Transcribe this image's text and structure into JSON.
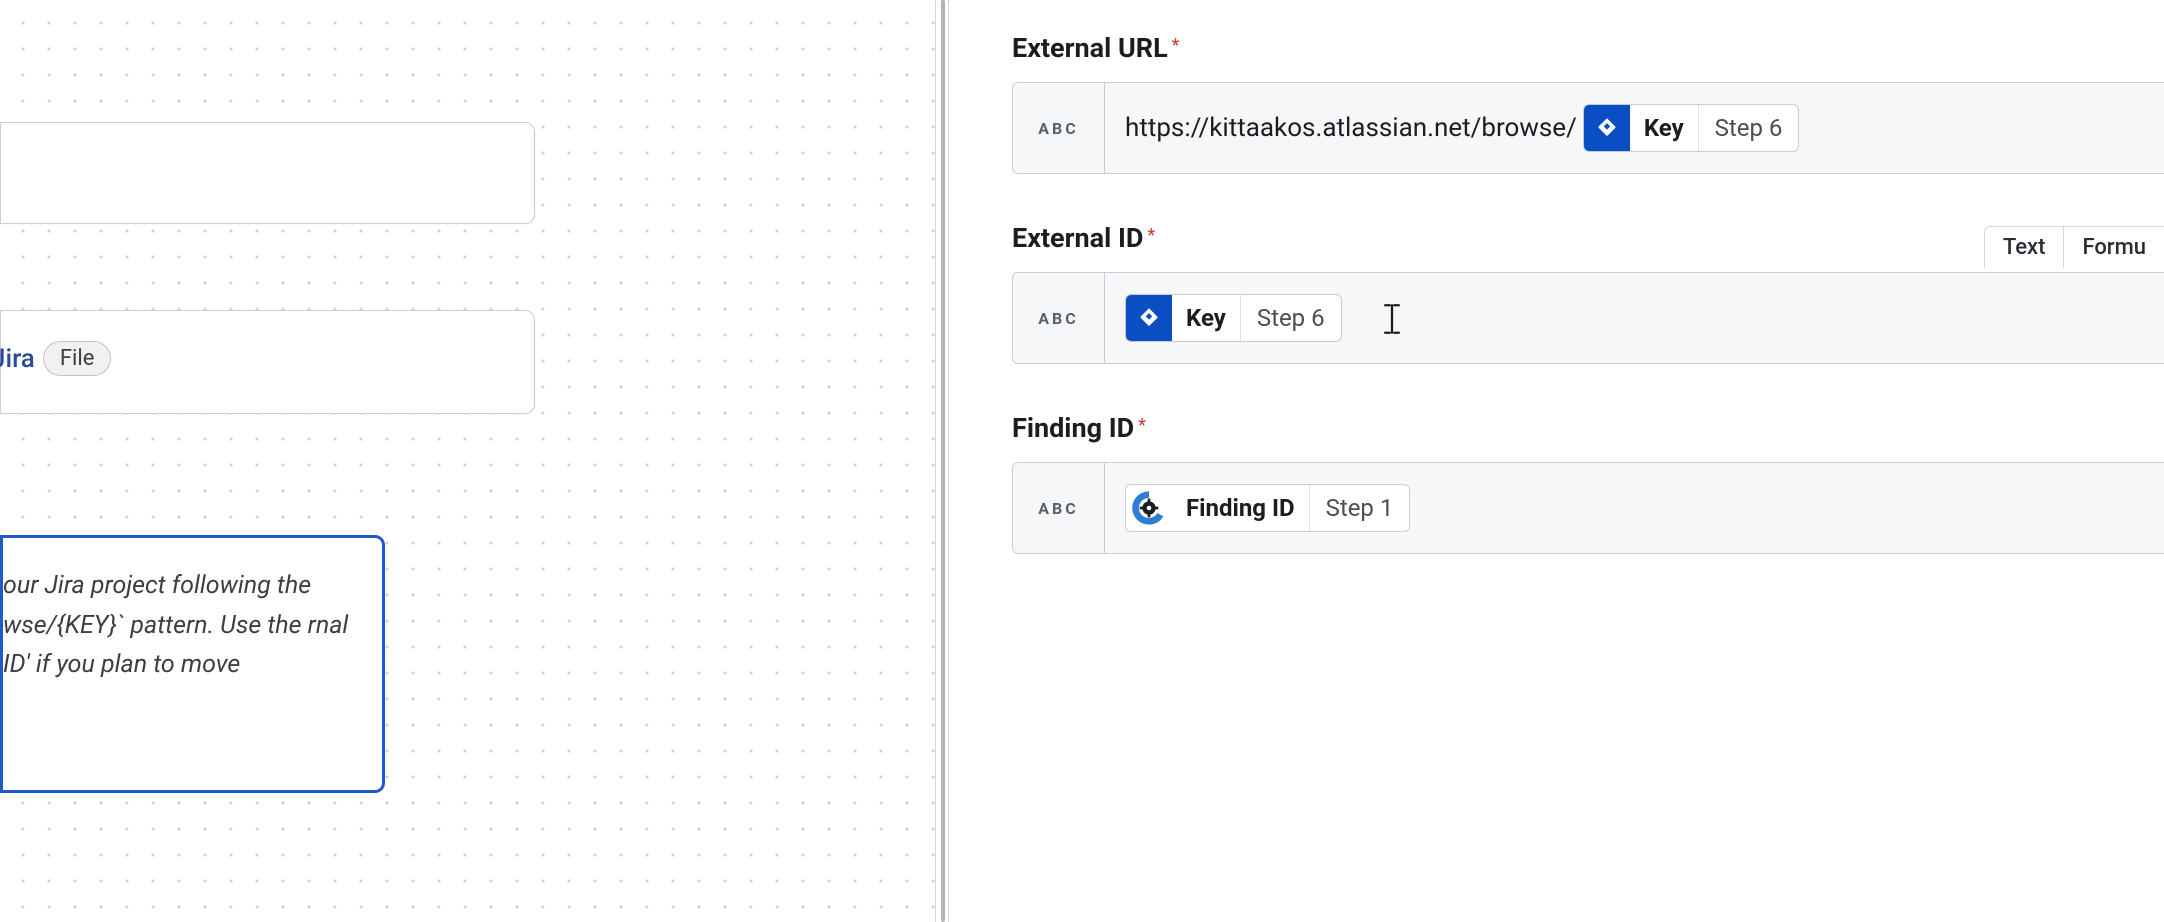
{
  "left": {
    "jira_label": "Jira",
    "file_chip": "File",
    "help_text": "our Jira project following the wse/{KEY}` pattern. Use the rnal ID' if you plan to move"
  },
  "right": {
    "fields": {
      "external_url": {
        "label": "External URL",
        "type_badge": "ABC",
        "raw_prefix": "https://kittaakos.atlassian.net/browse/",
        "pill_label": "Key",
        "pill_step": "Step 6"
      },
      "external_id": {
        "label": "External ID",
        "type_badge": "ABC",
        "tabs": {
          "text": "Text",
          "formula": "Formu"
        },
        "pill_label": "Key",
        "pill_step": "Step 6"
      },
      "finding_id": {
        "label": "Finding ID",
        "type_badge": "ABC",
        "pill_label": "Finding ID",
        "pill_step": "Step 1"
      }
    }
  }
}
